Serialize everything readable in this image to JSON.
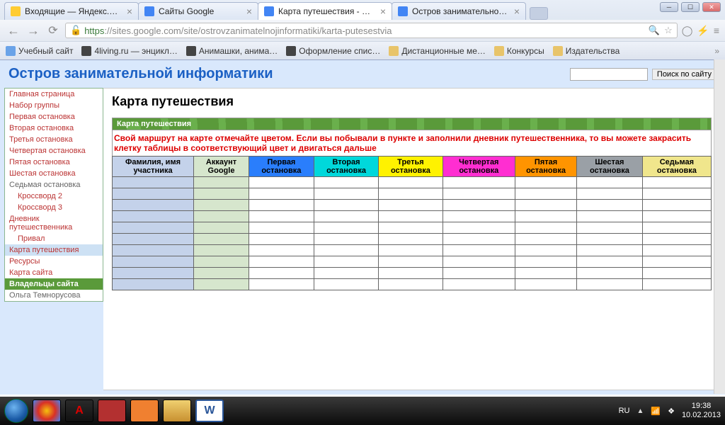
{
  "browser": {
    "tabs": [
      {
        "title": "Входящие — Яндекс.Поч"
      },
      {
        "title": "Сайты Google"
      },
      {
        "title": "Карта путешествия - Ост"
      },
      {
        "title": "Остров занимательной и"
      }
    ],
    "url_scheme": "https",
    "url_host": "://sites.google.com",
    "url_path": "/site/ostrovzanimatelnojinformatiki/karta-putesestvia",
    "bookmarks": [
      "Учебный сайт",
      "4living.ru — энцикл…",
      "Анимашки, анима…",
      "Оформление спис…",
      "Дистанционные ме…",
      "Конкурсы",
      "Издательства"
    ]
  },
  "site": {
    "title": "Остров занимательной информатики",
    "search_button": "Поиск по сайту"
  },
  "sidebar": {
    "items": [
      {
        "label": "Главная страница"
      },
      {
        "label": "Набор группы"
      },
      {
        "label": "Первая остановка"
      },
      {
        "label": "Вторая остановка"
      },
      {
        "label": "Третья остановка"
      },
      {
        "label": "Четвертая остановка"
      },
      {
        "label": "Пятая остановка"
      },
      {
        "label": "Шестая остановка"
      },
      {
        "label": "Седьмая остановка"
      },
      {
        "label": "Кроссворд 2"
      },
      {
        "label": "Кроссворд 3"
      },
      {
        "label": "Дневник путешественника"
      },
      {
        "label": "Привал"
      },
      {
        "label": "Карта путешествия"
      },
      {
        "label": "Ресурсы"
      },
      {
        "label": "Карта сайта"
      }
    ],
    "owners_header": "Владельцы сайта",
    "owner": "Ольга Темнорусова"
  },
  "main": {
    "heading": "Карта путешествия",
    "card_bar": "Карта путешествия",
    "instruction": "Свой маршрут на карте отмечайте цветом. Если вы побывали в пункте и заполнили дневник путешественника, то вы можете закрасить клетку таблицы в соответствующий цвет и двигаться дальше",
    "headers": [
      "Фамилия, имя участника",
      "Аккаунт Google",
      "Первая остановка",
      "Вторая остановка",
      "Третья остановка",
      "Четвертая остановка",
      "Пятая остановка",
      "Шестая остановка",
      "Седьмая остановка"
    ],
    "row_count": 10
  },
  "taskbar": {
    "lang": "RU",
    "time": "19:38",
    "date": "10.02.2013"
  }
}
